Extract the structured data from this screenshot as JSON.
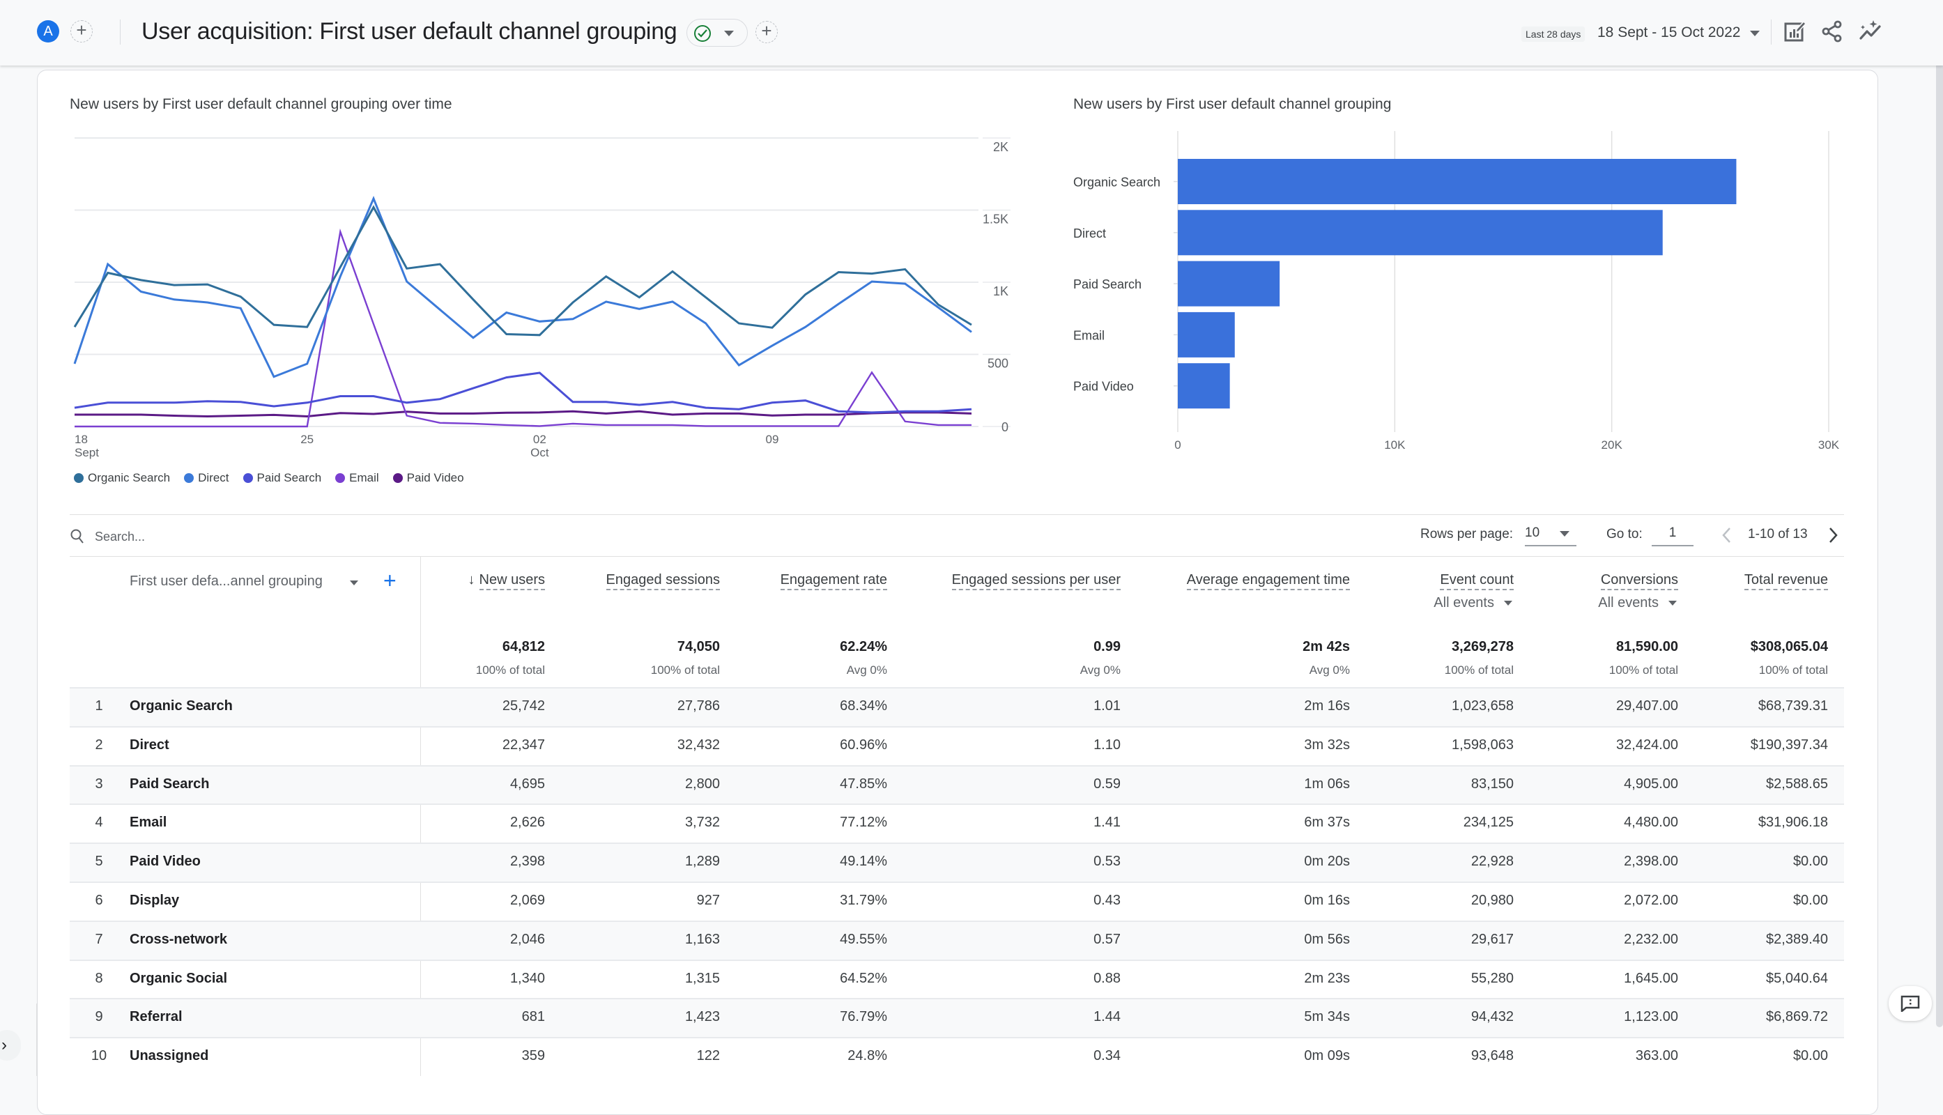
{
  "header": {
    "avatar_letter": "A",
    "title": "User acquisition: First user default channel grouping",
    "date_chip": "Last 28 days",
    "date_range": "18 Sept - 15 Oct 2022",
    "icons": [
      "customize-report-icon",
      "share-icon",
      "insights-icon"
    ]
  },
  "line_chart_title": "New users by First user default channel grouping over time",
  "bar_chart_title": "New users by First user default channel grouping",
  "colors": {
    "organic_search": "#2f6f9a",
    "direct": "#3b7ad9",
    "paid_search": "#4a4fd6",
    "email": "#7a3fd1",
    "paid_video": "#5b1a86",
    "bar": "#3a71db",
    "accent": "#1a73e8"
  },
  "chart_data": [
    {
      "type": "line",
      "title": "New users by First user default channel grouping over time",
      "xlabel": "",
      "ylabel": "",
      "x": [
        "18 Sept",
        "19",
        "20",
        "21",
        "22",
        "23",
        "24",
        "25",
        "26",
        "27",
        "28",
        "29",
        "30",
        "01 Oct",
        "02",
        "03",
        "04",
        "05",
        "06",
        "07",
        "08",
        "09",
        "10",
        "11",
        "12",
        "13",
        "14",
        "15"
      ],
      "x_ticks": [
        {
          "index": 0,
          "label": "18",
          "sub": "Sept"
        },
        {
          "index": 7,
          "label": "25",
          "sub": ""
        },
        {
          "index": 14,
          "label": "02",
          "sub": "Oct"
        },
        {
          "index": 21,
          "label": "09",
          "sub": ""
        }
      ],
      "y_ticks": [
        {
          "value": 0,
          "label": "0"
        },
        {
          "value": 500,
          "label": "500"
        },
        {
          "value": 1000,
          "label": "1K"
        },
        {
          "value": 1500,
          "label": "1.5K"
        },
        {
          "value": 2000,
          "label": "2K"
        }
      ],
      "ylim": [
        0,
        2000
      ],
      "grid": true,
      "legend": "bottom-left",
      "series": [
        {
          "name": "Organic Search",
          "key": "organic_search",
          "values": [
            690,
            1065,
            1015,
            980,
            985,
            900,
            705,
            690,
            1105,
            1520,
            1095,
            1125,
            880,
            640,
            634,
            860,
            1040,
            895,
            1075,
            895,
            715,
            685,
            915,
            1070,
            1060,
            1090,
            845,
            705
          ]
        },
        {
          "name": "Direct",
          "key": "direct",
          "values": [
            435,
            1125,
            935,
            880,
            860,
            820,
            345,
            435,
            1040,
            1580,
            1005,
            810,
            615,
            790,
            728,
            745,
            865,
            815,
            865,
            715,
            425,
            560,
            690,
            850,
            1005,
            990,
            825,
            655
          ]
        },
        {
          "name": "Paid Search",
          "key": "paid_search",
          "values": [
            130,
            165,
            165,
            165,
            175,
            170,
            140,
            165,
            210,
            210,
            165,
            190,
            265,
            340,
            372,
            170,
            170,
            150,
            170,
            130,
            120,
            165,
            180,
            105,
            97,
            105,
            105,
            120
          ]
        },
        {
          "name": "Email",
          "key": "email",
          "values": [
            0,
            0,
            0,
            0,
            0,
            0,
            0,
            0,
            1350,
            710,
            75,
            25,
            20,
            10,
            3,
            20,
            10,
            10,
            10,
            3,
            3,
            3,
            3,
            3,
            375,
            35,
            10,
            10
          ]
        },
        {
          "name": "Paid Video",
          "key": "paid_video",
          "values": [
            82,
            82,
            82,
            75,
            70,
            75,
            80,
            70,
            93,
            87,
            103,
            90,
            90,
            95,
            97,
            105,
            90,
            105,
            82,
            90,
            90,
            76,
            82,
            82,
            92,
            97,
            97,
            90
          ]
        }
      ]
    },
    {
      "type": "bar",
      "orientation": "horizontal",
      "title": "New users by First user default channel grouping",
      "categories": [
        "Organic Search",
        "Direct",
        "Paid Search",
        "Email",
        "Paid Video"
      ],
      "values": [
        25742,
        22347,
        4695,
        2626,
        2398
      ],
      "x_ticks": [
        {
          "value": 0,
          "label": "0"
        },
        {
          "value": 10000,
          "label": "10K"
        },
        {
          "value": 20000,
          "label": "20K"
        },
        {
          "value": 30000,
          "label": "30K"
        }
      ],
      "xlim": [
        0,
        30000
      ],
      "xlabel": "",
      "ylabel": "",
      "grid": true
    }
  ],
  "table": {
    "search_placeholder": "Search...",
    "rows_per_page_label": "Rows per page:",
    "rows_per_page_value": "10",
    "goto_label": "Go to:",
    "goto_value": "1",
    "page_info": "1-10 of 13",
    "dimension_header": "First user defa...annel grouping",
    "sort_arrow": "↓",
    "columns": [
      {
        "label": "New users",
        "sub": "",
        "total": "64,812",
        "total_sub": "100% of total"
      },
      {
        "label": "Engaged sessions",
        "sub": "",
        "total": "74,050",
        "total_sub": "100% of total"
      },
      {
        "label": "Engagement rate",
        "sub": "",
        "total": "62.24%",
        "total_sub": "Avg 0%"
      },
      {
        "label": "Engaged sessions per user",
        "sub": "",
        "total": "0.99",
        "total_sub": "Avg 0%"
      },
      {
        "label": "Average engagement time",
        "sub": "",
        "total": "2m 42s",
        "total_sub": "Avg 0%"
      },
      {
        "label": "Event count",
        "sub": "All events",
        "total": "3,269,278",
        "total_sub": "100% of total"
      },
      {
        "label": "Conversions",
        "sub": "All events",
        "total": "81,590.00",
        "total_sub": "100% of total"
      },
      {
        "label": "Total revenue",
        "sub": "",
        "total": "$308,065.04",
        "total_sub": "100% of total"
      }
    ],
    "rows": [
      {
        "num": "1",
        "name": "Organic Search",
        "cells": [
          "25,742",
          "27,786",
          "68.34%",
          "1.01",
          "2m 16s",
          "1,023,658",
          "29,407.00",
          "$68,739.31"
        ]
      },
      {
        "num": "2",
        "name": "Direct",
        "cells": [
          "22,347",
          "32,432",
          "60.96%",
          "1.10",
          "3m 32s",
          "1,598,063",
          "32,424.00",
          "$190,397.34"
        ]
      },
      {
        "num": "3",
        "name": "Paid Search",
        "cells": [
          "4,695",
          "2,800",
          "47.85%",
          "0.59",
          "1m 06s",
          "83,150",
          "4,905.00",
          "$2,588.65"
        ]
      },
      {
        "num": "4",
        "name": "Email",
        "cells": [
          "2,626",
          "3,732",
          "77.12%",
          "1.41",
          "6m 37s",
          "234,125",
          "4,480.00",
          "$31,906.18"
        ]
      },
      {
        "num": "5",
        "name": "Paid Video",
        "cells": [
          "2,398",
          "1,289",
          "49.14%",
          "0.53",
          "0m 20s",
          "22,928",
          "2,398.00",
          "$0.00"
        ]
      },
      {
        "num": "6",
        "name": "Display",
        "cells": [
          "2,069",
          "927",
          "31.79%",
          "0.43",
          "0m 16s",
          "20,980",
          "2,072.00",
          "$0.00"
        ]
      },
      {
        "num": "7",
        "name": "Cross-network",
        "cells": [
          "2,046",
          "1,163",
          "49.55%",
          "0.57",
          "0m 56s",
          "29,617",
          "2,232.00",
          "$2,389.40"
        ]
      },
      {
        "num": "8",
        "name": "Organic Social",
        "cells": [
          "1,340",
          "1,315",
          "64.52%",
          "0.88",
          "2m 23s",
          "55,280",
          "1,645.00",
          "$5,040.64"
        ]
      },
      {
        "num": "9",
        "name": "Referral",
        "cells": [
          "681",
          "1,423",
          "76.79%",
          "1.44",
          "5m 34s",
          "94,432",
          "1,123.00",
          "$6,869.72"
        ]
      },
      {
        "num": "10",
        "name": "Unassigned",
        "cells": [
          "359",
          "122",
          "24.8%",
          "0.34",
          "0m 09s",
          "93,648",
          "363.00",
          "$0.00"
        ]
      }
    ]
  }
}
